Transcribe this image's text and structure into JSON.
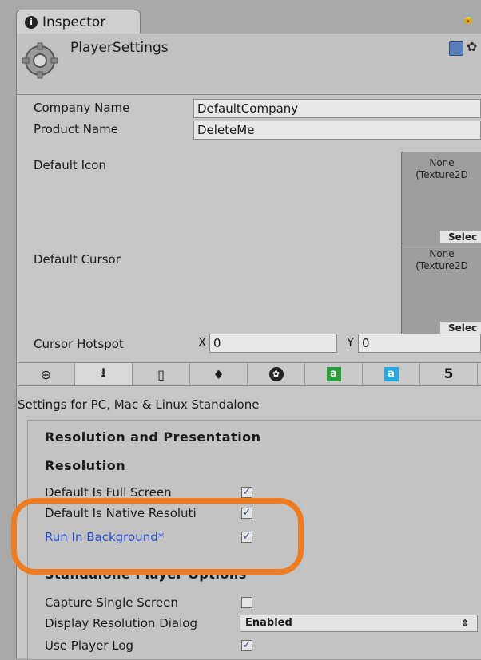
{
  "tab": {
    "label": "Inspector"
  },
  "header": {
    "title": "PlayerSettings"
  },
  "fields": {
    "company_name": {
      "label": "Company Name",
      "value": "DefaultCompany"
    },
    "product_name": {
      "label": "Product Name",
      "value": "DeleteMe"
    },
    "default_icon": {
      "label": "Default Icon",
      "none_line1": "None",
      "none_line2": "(Texture2D",
      "select": "Selec"
    },
    "default_cursor": {
      "label": "Default Cursor",
      "none_line1": "None",
      "none_line2": "(Texture2D",
      "select": "Selec"
    },
    "cursor_hotspot": {
      "label": "Cursor Hotspot",
      "x_label": "X",
      "x_value": "0",
      "y_label": "Y",
      "y_value": "0"
    }
  },
  "platforms": [
    "globe-icon",
    "download-icon",
    "phone-icon",
    "pin-icon",
    "blackberry-icon",
    "android-icon",
    "android-blue-icon",
    "html5-icon"
  ],
  "settings_for": "Settings for PC, Mac & Linux Standalone",
  "section": {
    "title": "Resolution and Presentation",
    "resolution": "Resolution",
    "rows": [
      {
        "label": "Default Is Full Screen",
        "checked": true
      },
      {
        "label": "Default Is Native Resoluti",
        "checked": true
      },
      {
        "label": "Run In Background*",
        "checked": true
      }
    ],
    "standalone_header": "Standalone Player Options",
    "capture_single_screen": {
      "label": "Capture Single Screen",
      "checked": false
    },
    "display_resolution_dialog": {
      "label": "Display Resolution Dialog",
      "value": "Enabled"
    },
    "use_player_log": {
      "label": "Use Player Log",
      "checked": true
    }
  },
  "colors": {
    "highlight": "#f07c22",
    "link_blue": "#2b4ecf"
  }
}
